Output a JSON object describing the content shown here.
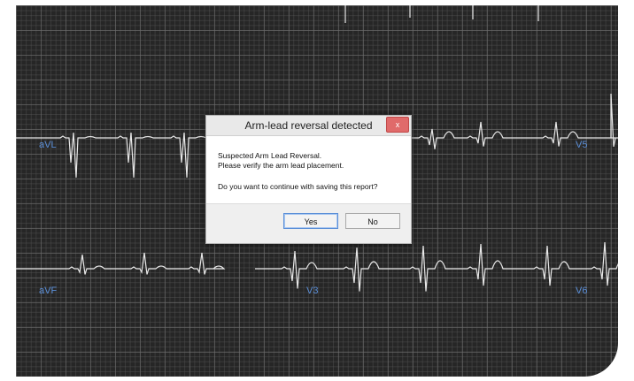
{
  "leads": [
    "aVL",
    "V5",
    "aVF",
    "V3",
    "V6"
  ],
  "dialog": {
    "title": "Arm-lead reversal detected",
    "close_glyph": "x",
    "message_line1": "Suspected Arm Lead Reversal.",
    "message_line2": "Please verify the arm lead placement.",
    "question": "Do you want to continue with saving this report?",
    "yes_label": "Yes",
    "no_label": "No"
  },
  "colors": {
    "grid_background": "#262626",
    "trace": "#e8e8e8",
    "lead_label": "#5b8fd8",
    "close_button": "#e06a6a"
  }
}
